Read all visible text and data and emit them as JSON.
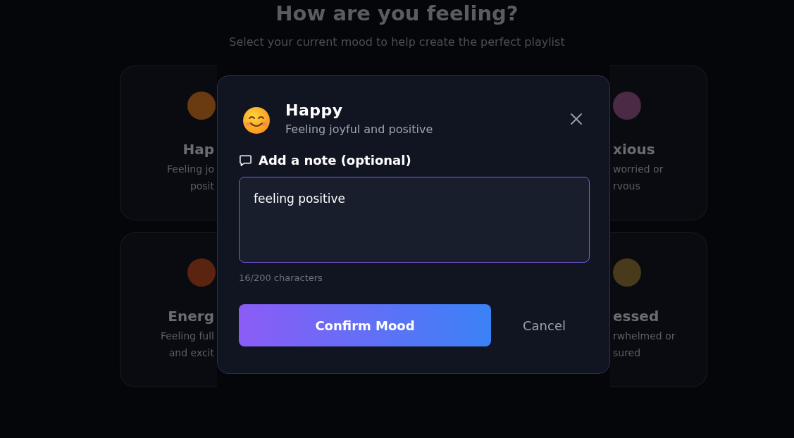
{
  "page": {
    "title": "How are you feeling?",
    "subtitle": "Select your current mood to help create the perfect playlist"
  },
  "mood_card_rows": [
    [
      {
        "title": "Hap",
        "description": [
          "Feeling jo",
          "posit"
        ],
        "color": "#6a3a10"
      },
      {
        "title": "xious",
        "description": [
          "worried or",
          "rvous"
        ],
        "color": "#4a2a44"
      }
    ],
    [
      {
        "title": "Energ",
        "description": [
          "Feeling full",
          "and excit"
        ],
        "color": "#5a2410"
      },
      {
        "title": "essed",
        "description": [
          "rwhelmed or",
          "sured"
        ],
        "color": "#4a3a1c"
      }
    ]
  ],
  "dialog": {
    "title": "Happy",
    "subtitle": "Feeling joyful and positive",
    "note_label": "Add a note (optional)",
    "note_value": "feeling positive",
    "counter": "16/200 characters",
    "confirm": "Confirm Mood",
    "cancel": "Cancel"
  }
}
